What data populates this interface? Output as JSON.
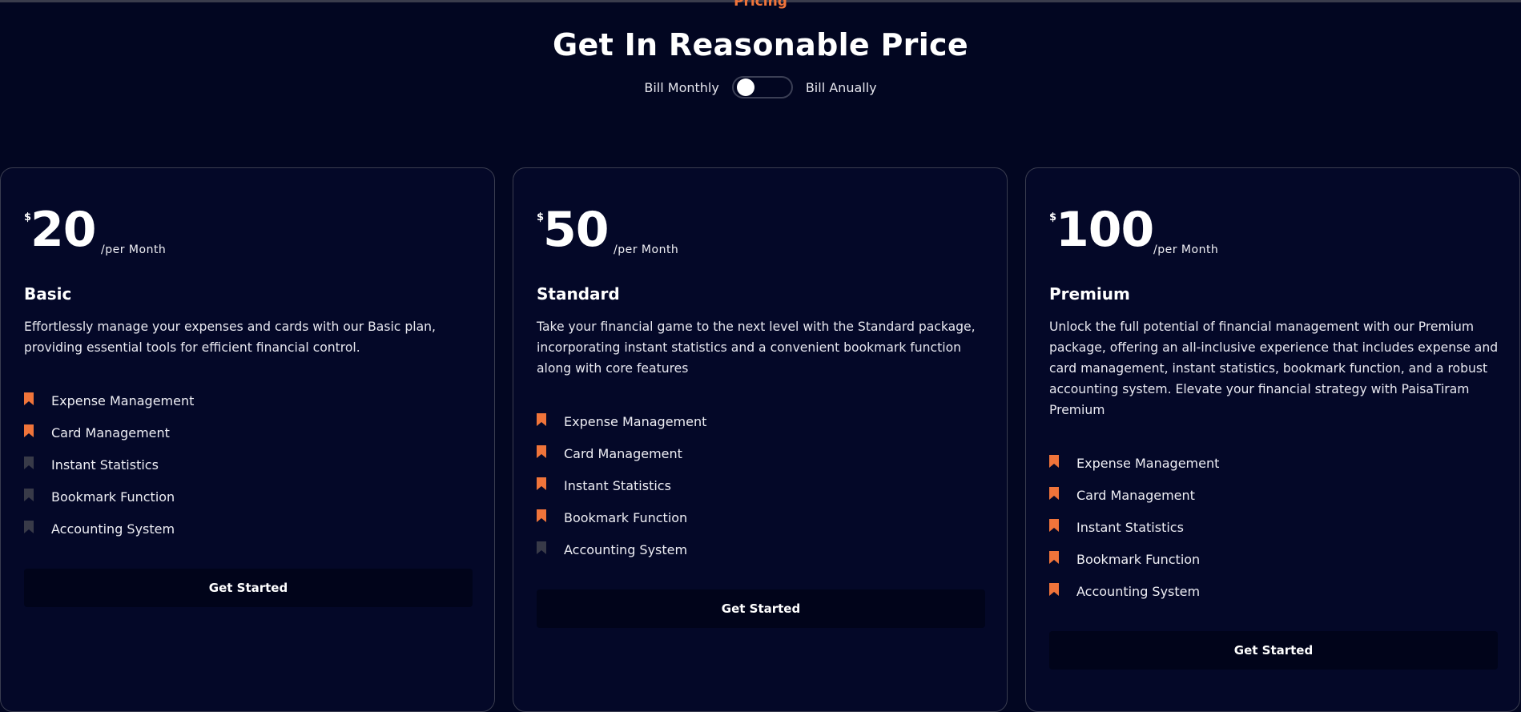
{
  "header": {
    "eyebrow": "Pricing",
    "title": "Get In Reasonable Price"
  },
  "billing": {
    "monthly_label": "Bill Monthly",
    "annual_label": "Bill Anually",
    "annual_selected": false
  },
  "colors": {
    "accent": "#f0743a",
    "inactive_icon": "#383a48",
    "background": "#020621"
  },
  "plans": [
    {
      "currency": "$",
      "amount": "20",
      "period": "/per Month",
      "name": "Basic",
      "description": "Effortlessly manage your expenses and cards with our Basic plan, providing essential tools for efficient financial control.",
      "features": [
        {
          "label": "Expense Management",
          "included": true
        },
        {
          "label": "Card Management",
          "included": true
        },
        {
          "label": "Instant Statistics",
          "included": false
        },
        {
          "label": "Bookmark Function",
          "included": false
        },
        {
          "label": "Accounting System",
          "included": false
        }
      ],
      "cta": "Get Started"
    },
    {
      "currency": "$",
      "amount": "50",
      "period": "/per Month",
      "name": "Standard",
      "description": "Take your financial game to the next level with the Standard package, incorporating instant statistics and a convenient bookmark function along with core features",
      "features": [
        {
          "label": "Expense Management",
          "included": true
        },
        {
          "label": "Card Management",
          "included": true
        },
        {
          "label": "Instant Statistics",
          "included": true
        },
        {
          "label": "Bookmark Function",
          "included": true
        },
        {
          "label": "Accounting System",
          "included": false
        }
      ],
      "cta": "Get Started"
    },
    {
      "currency": "$",
      "amount": "100",
      "period": "/per Month",
      "name": "Premium",
      "description": "Unlock the full potential of financial management with our Premium package, offering an all-inclusive experience that includes expense and card management, instant statistics, bookmark function, and a robust accounting system. Elevate your financial strategy with PaisaTiram Premium",
      "features": [
        {
          "label": "Expense Management",
          "included": true
        },
        {
          "label": "Card Management",
          "included": true
        },
        {
          "label": "Instant Statistics",
          "included": true
        },
        {
          "label": "Bookmark Function",
          "included": true
        },
        {
          "label": "Accounting System",
          "included": true
        }
      ],
      "cta": "Get Started"
    }
  ]
}
